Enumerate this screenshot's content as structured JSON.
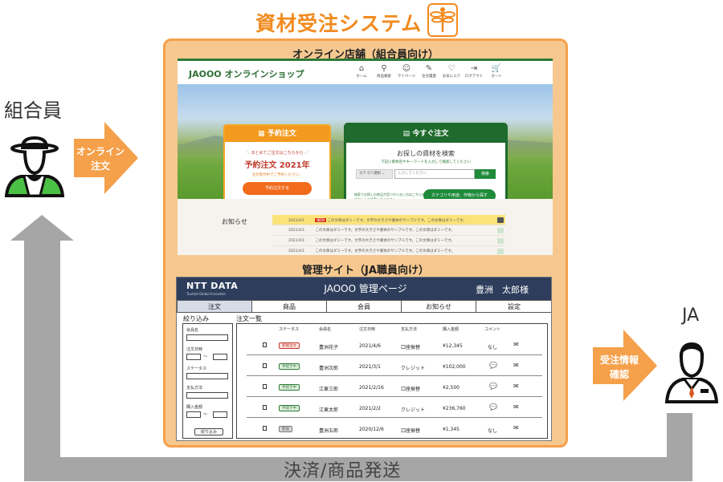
{
  "title": "資材受注システム",
  "actors": {
    "member": "組合員",
    "ja": "JA"
  },
  "arrows": {
    "online_order": [
      "オンライン",
      "注文"
    ],
    "order_check": [
      "受注情報",
      "確認"
    ],
    "settlement": "決済/商品発送"
  },
  "shop": {
    "header": "オンライン店舗（組合員向け）",
    "logo": "JAOOO オンラインショップ",
    "nav": [
      {
        "icon": "⌂",
        "label": "ホーム"
      },
      {
        "icon": "⚲",
        "label": "商品検索"
      },
      {
        "icon": "☺",
        "label": "マイページ"
      },
      {
        "icon": "✎",
        "label": "注文履歴"
      },
      {
        "icon": "♡",
        "label": "お気に入り"
      },
      {
        "icon": "⇥",
        "label": "ログアウト"
      },
      {
        "icon": "🛒",
        "label": "カート"
      }
    ],
    "reserve": {
      "head": "予約注文",
      "sub": "＼ まとめてご注文はこちらから ／",
      "main": "予約注文 2021年",
      "note": "注文受付中でご予約ください。",
      "button": "予約注文する"
    },
    "now": {
      "head": "今すぐ注文",
      "title": "お探しの資材を検索",
      "sub": "下記に資材名やキーワードを入力して検索してください",
      "category": "カテゴリ選択",
      "placeholder": "入力してください",
      "search_button": "検索",
      "help": "検索でお探しの商品が見つからない方はこちらのボタンより検索してください。",
      "category_button": "カテゴリや用途、作物から探す"
    },
    "news": {
      "label": "お知らせ",
      "rows": [
        {
          "date": "2021/4/1",
          "badge": "NEW",
          "text": "この文章はダミーです。文字の大きさや書体のサンプルです。この文章はダミーです。"
        },
        {
          "date": "2021/4/1",
          "text": "この文章はダミーです。文字の大きさや書体のサンプルです。この文章はダミーです。"
        },
        {
          "date": "2021/4/1",
          "text": "この文章はダミーです。文字の大きさや書体のサンプルです。この文章はダミーです。"
        },
        {
          "date": "2021/4/1",
          "text": "この文章はダミーです。文字の大きさや書体のサンプルです。この文章はダミーです。"
        }
      ]
    }
  },
  "admin": {
    "header": "管理サイト（JA職員向け）",
    "logo": "NTT DATA",
    "logo_sub": "Trusted Global Innovator",
    "title": "JAOOO 管理ページ",
    "user": "豊洲　太郎様",
    "tabs": [
      "注文",
      "商品",
      "会員",
      "お知らせ",
      "設定"
    ],
    "filter": {
      "title": "絞り込み",
      "fields": [
        "会員名",
        "注文日時",
        "ステータス",
        "支払方法",
        "購入金額"
      ],
      "range_sep": "～",
      "button": "絞り込み"
    },
    "list": {
      "title": "注文一覧",
      "columns": [
        "ステータス",
        "会員名",
        "注文日時",
        "支払方法",
        "購入金額",
        "コメント"
      ],
      "rows": [
        {
          "status": "新規注文",
          "status_type": "new",
          "member": "豊洲花子",
          "date": "2021/4/6",
          "payment": "口座振替",
          "amount": "¥12,345",
          "comment": "なし"
        },
        {
          "status": "手続き中",
          "status_type": "proc",
          "member": "豊洲次郎",
          "date": "2021/3/1",
          "payment": "クレジット",
          "amount": "¥102,000",
          "comment": "icon"
        },
        {
          "status": "手続き中",
          "status_type": "proc",
          "member": "江東三郎",
          "date": "2021/2/16",
          "payment": "口座振替",
          "amount": "¥2,500",
          "comment": "icon"
        },
        {
          "status": "手続き中",
          "status_type": "proc",
          "member": "江東太郎",
          "date": "2021/2/2",
          "payment": "クレジット",
          "amount": "¥236,760",
          "comment": "icon"
        },
        {
          "status": "配送",
          "status_type": "done",
          "member": "豊洲五郎",
          "date": "2020/12/6",
          "payment": "口座振替",
          "amount": "¥1,345",
          "comment": "なし"
        }
      ]
    }
  },
  "colors": {
    "orange": "#f28a1e",
    "panel": "#f6c88f",
    "gray_arrow": "#a6a6a6",
    "green": "#2d7a37",
    "navy": "#2e3d5c"
  }
}
